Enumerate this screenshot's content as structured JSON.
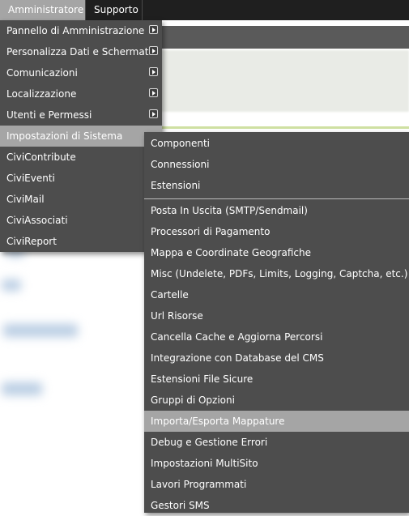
{
  "menubar": {
    "items": [
      {
        "label": "Amministratore",
        "active": true
      },
      {
        "label": "Supporto",
        "active": false
      }
    ]
  },
  "admin_menu": {
    "items": [
      {
        "label": "Pannello di Amministrazione",
        "submenu": true,
        "icon": "submenu-arrow-icon"
      },
      {
        "label": "Personalizza Dati e Schermate",
        "submenu": true,
        "icon": "submenu-arrow-icon"
      },
      {
        "label": "Comunicazioni",
        "submenu": true,
        "icon": "submenu-arrow-icon"
      },
      {
        "label": "Localizzazione",
        "submenu": true,
        "icon": "submenu-arrow-icon"
      },
      {
        "label": "Utenti e Permessi",
        "submenu": true,
        "icon": "submenu-arrow-icon"
      },
      {
        "label": "Impostazioni di Sistema",
        "submenu": false,
        "highlighted": true
      },
      {
        "label": "CiviContribute",
        "submenu": false
      },
      {
        "label": "CiviEventi",
        "submenu": false
      },
      {
        "label": "CiviMail",
        "submenu": false
      },
      {
        "label": "CiviAssociati",
        "submenu": false
      },
      {
        "label": "CiviReport",
        "submenu": false
      }
    ]
  },
  "system_submenu": {
    "group_top": [
      {
        "label": "Componenti"
      },
      {
        "label": "Connessioni"
      },
      {
        "label": "Estensioni"
      }
    ],
    "group_bottom": [
      {
        "label": "Posta In Uscita (SMTP/Sendmail)"
      },
      {
        "label": "Processori di Pagamento"
      },
      {
        "label": "Mappa e Coordinate Geografiche"
      },
      {
        "label": "Misc (Undelete, PDFs, Limits, Logging, Captcha, etc.)"
      },
      {
        "label": "Cartelle"
      },
      {
        "label": "Url Risorse"
      },
      {
        "label": "Cancella Cache e Aggiorna Percorsi"
      },
      {
        "label": "Integrazione con Database del CMS"
      },
      {
        "label": "Estensioni File Sicure"
      },
      {
        "label": "Gruppi di Opzioni"
      },
      {
        "label": "Importa/Esporta Mappature",
        "highlighted": true
      },
      {
        "label": "Debug e Gestione Errori"
      },
      {
        "label": "Impostazioni MultiSito"
      },
      {
        "label": "Lavori Programmati"
      },
      {
        "label": "Gestori SMS"
      }
    ]
  },
  "colors": {
    "menubar_bg": "#1f1f1f",
    "menu_bg": "#4d4d4d",
    "highlight_bg": "#a5a5a5",
    "text": "#ffffff"
  }
}
